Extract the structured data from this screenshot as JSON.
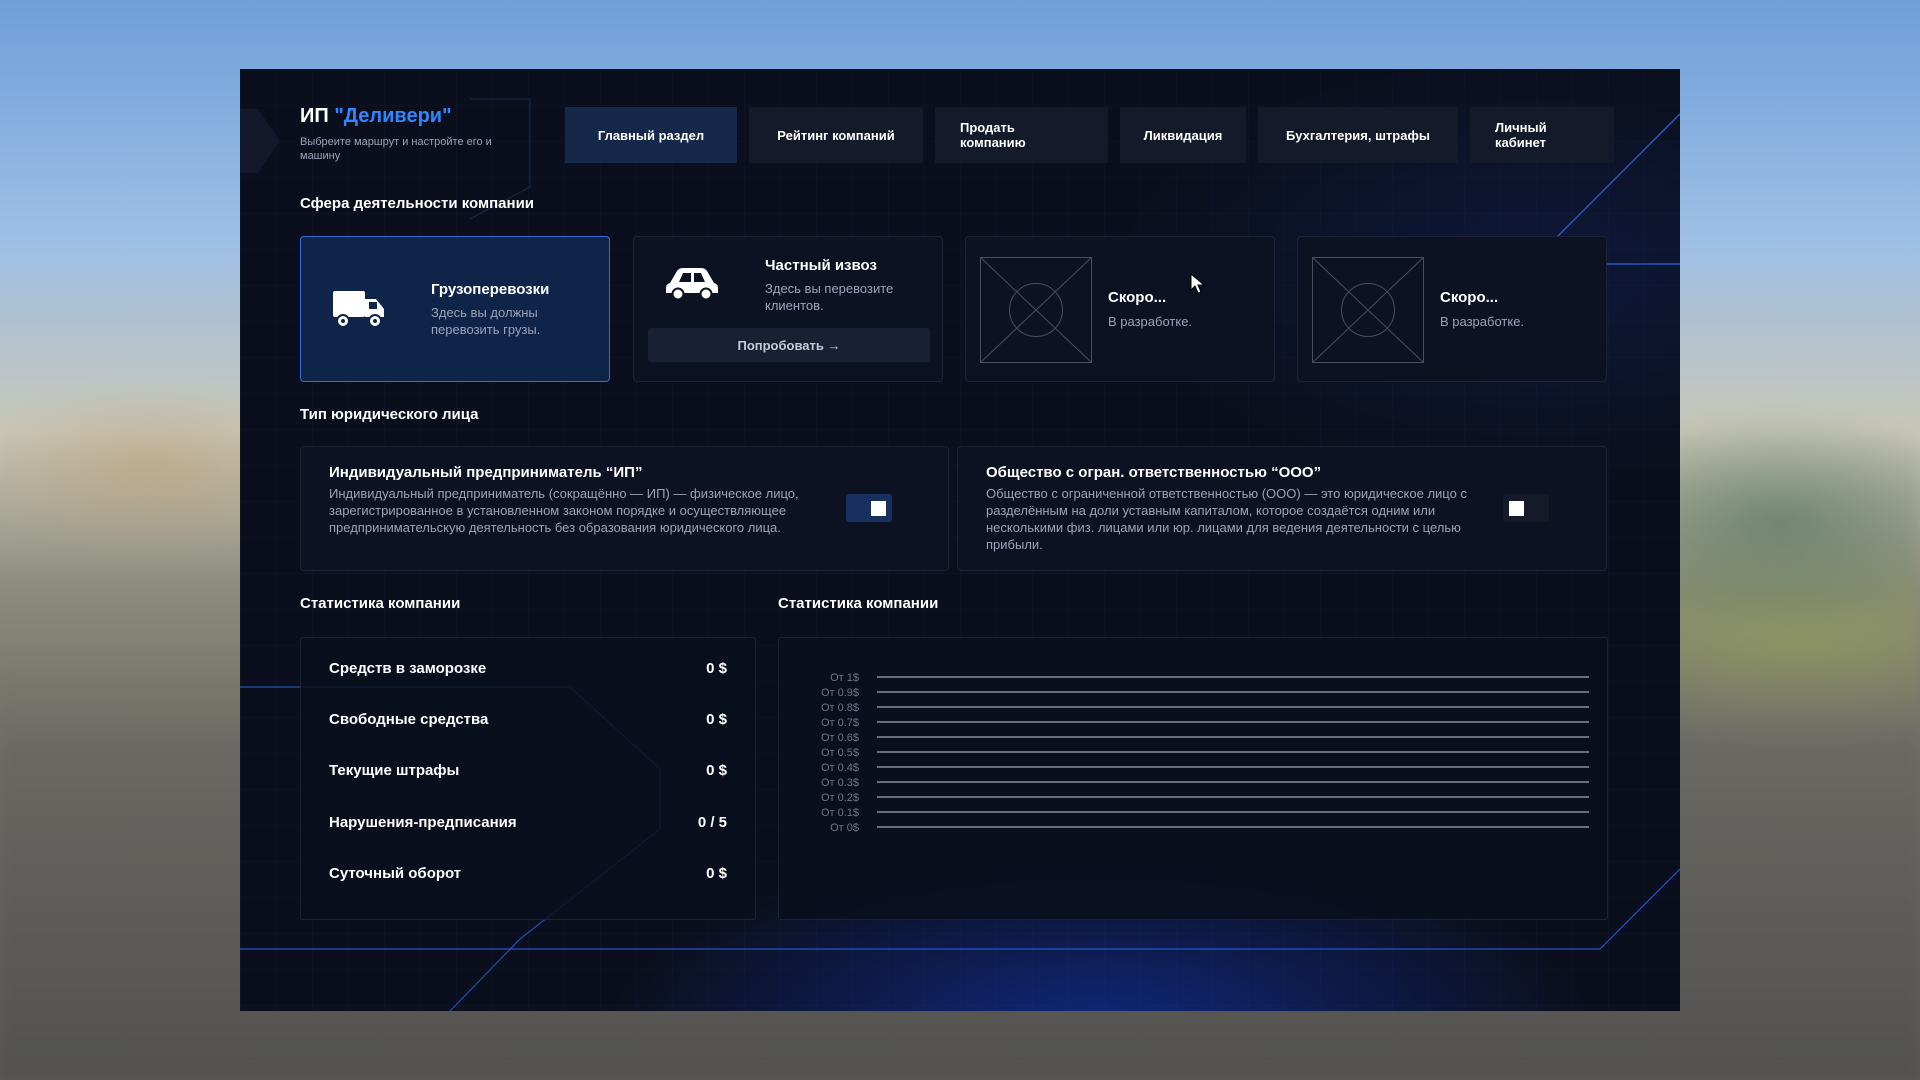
{
  "header": {
    "title_prefix": "ИП ",
    "title_brand": "\"Деливери\"",
    "subtitle": "Выбреите маршрут и настройте его и машину"
  },
  "tabs": [
    {
      "label": "Главный раздел",
      "active": true
    },
    {
      "label": "Рейтинг компаний",
      "active": false
    },
    {
      "label": "Продать компанию",
      "active": false
    },
    {
      "label": "Ликвидация",
      "active": false
    },
    {
      "label": "Бухгалтерия, штрафы",
      "active": false
    },
    {
      "label": "Личный кабинет",
      "active": false
    }
  ],
  "activity": {
    "section_title": "Сфера деятельности компании",
    "cards": [
      {
        "title": "Грузоперевозки",
        "desc": "Здесь вы должны перевозить грузы.",
        "icon": "truck-icon",
        "active": true
      },
      {
        "title": "Частный извоз",
        "desc": "Здесь вы перевозите клиентов.",
        "icon": "car-icon",
        "button": "Попробовать →"
      },
      {
        "title": "Скоро...",
        "desc": "В разработке.",
        "icon": "placeholder-image"
      },
      {
        "title": "Скоро...",
        "desc": "В разработке.",
        "icon": "placeholder-image"
      }
    ]
  },
  "legal": {
    "section_title": "Тип юридического лица",
    "options": [
      {
        "title": "Индивидуальный предприниматель “ИП”",
        "desc": "Индивидуальный предприниматель (сокращённо — ИП) — физическое лицо, зарегистрированное в установленном законом порядке и осуществляющее предпринимательскую деятельность без образования юридического лица.",
        "checked": true
      },
      {
        "title": "Общество с огран. ответственностью “ООО”",
        "desc": "Общество с ограниченной ответственностью (ООО) — это юридическое лицо с разделённым на доли уставным капиталом, которое создаётся одним или несколькими физ. лицами или юр. лицами для ведения деятельности с целью прибыли.",
        "checked": false
      }
    ]
  },
  "stats": {
    "section_title": "Статистика компании",
    "rows": [
      {
        "label": "Средств в заморозке",
        "value": "0 $"
      },
      {
        "label": "Свободные средства",
        "value": "0 $"
      },
      {
        "label": "Текущие штрафы",
        "value": "0 $"
      },
      {
        "label": "Нарушения-предписания",
        "value": "0 / 5"
      },
      {
        "label": "Суточный оборот",
        "value": "0 $"
      }
    ]
  },
  "chart_section_title": "Статистика компании",
  "chart_data": {
    "type": "line",
    "title": "",
    "ylabels": [
      "От 1$",
      "От 0.9$",
      "От 0.8$",
      "От 0.7$",
      "От 0.6$",
      "От 0.5$",
      "От 0.4$",
      "От 0.3$",
      "От 0.2$",
      "От 0.1$",
      "От 0$"
    ],
    "ylim": [
      0,
      1
    ],
    "series": [],
    "grid": true
  },
  "colors": {
    "accent": "#2f86ff",
    "panel": "#0b0f1d",
    "card": "#0d1222",
    "active_card": "#0f2449"
  }
}
